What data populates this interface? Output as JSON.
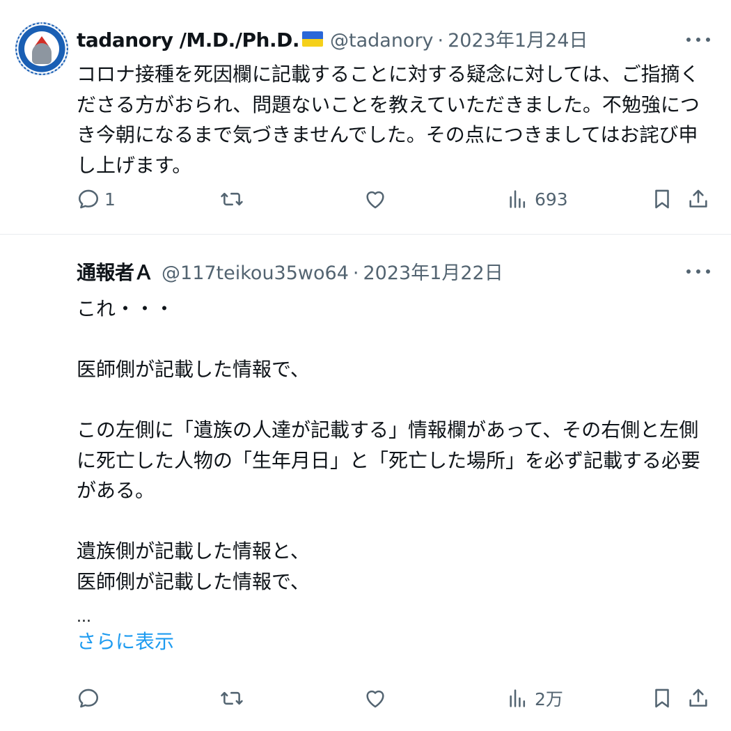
{
  "tweets": [
    {
      "display_name": "tadanory /M.D./Ph.D.",
      "handle": "@tadanory",
      "dot": "·",
      "date": "2023年1月24日",
      "body": [
        "コロナ接種を死因欄に記載することに対する疑念に対しては、ご指摘くださる方がおられ、問題ないことを教えていただきました。不勉強につき今朝になるまで気づきませんでした。その点につきましてはお詫び申し上げます。"
      ],
      "reply_count": "1",
      "retweet_count": "",
      "like_count": "",
      "view_count": "693"
    },
    {
      "display_name": "通報者Ａ",
      "handle": "@117teikou35wo64",
      "dot": "·",
      "date": "2023年1月22日",
      "body": [
        "これ・・・",
        "",
        "医師側が記載した情報で、",
        "",
        "この左側に「遺族の人達が記載する」情報欄があって、その右側と左側に死亡した人物の「生年月日」と「死亡した場所」を必ず記載する必要がある。",
        "",
        "遺族側が記載した情報と、",
        "医師側が記載した情報で、",
        "",
        "..."
      ],
      "show_more": "さらに表示",
      "reply_count": "",
      "retweet_count": "",
      "like_count": "",
      "view_count": "2万"
    }
  ],
  "icons": {
    "more": "more-horizontal-icon",
    "reply": "reply-bubble-icon",
    "retweet": "retweet-icon",
    "like": "heart-icon",
    "views": "analytics-bars-icon",
    "bookmark": "bookmark-icon",
    "share": "share-upload-icon",
    "flag": "ukraine-flag-icon"
  },
  "colors": {
    "text": "#0f1419",
    "secondary": "#536471",
    "link": "#1d9bf0",
    "divider": "#e8ecee"
  }
}
